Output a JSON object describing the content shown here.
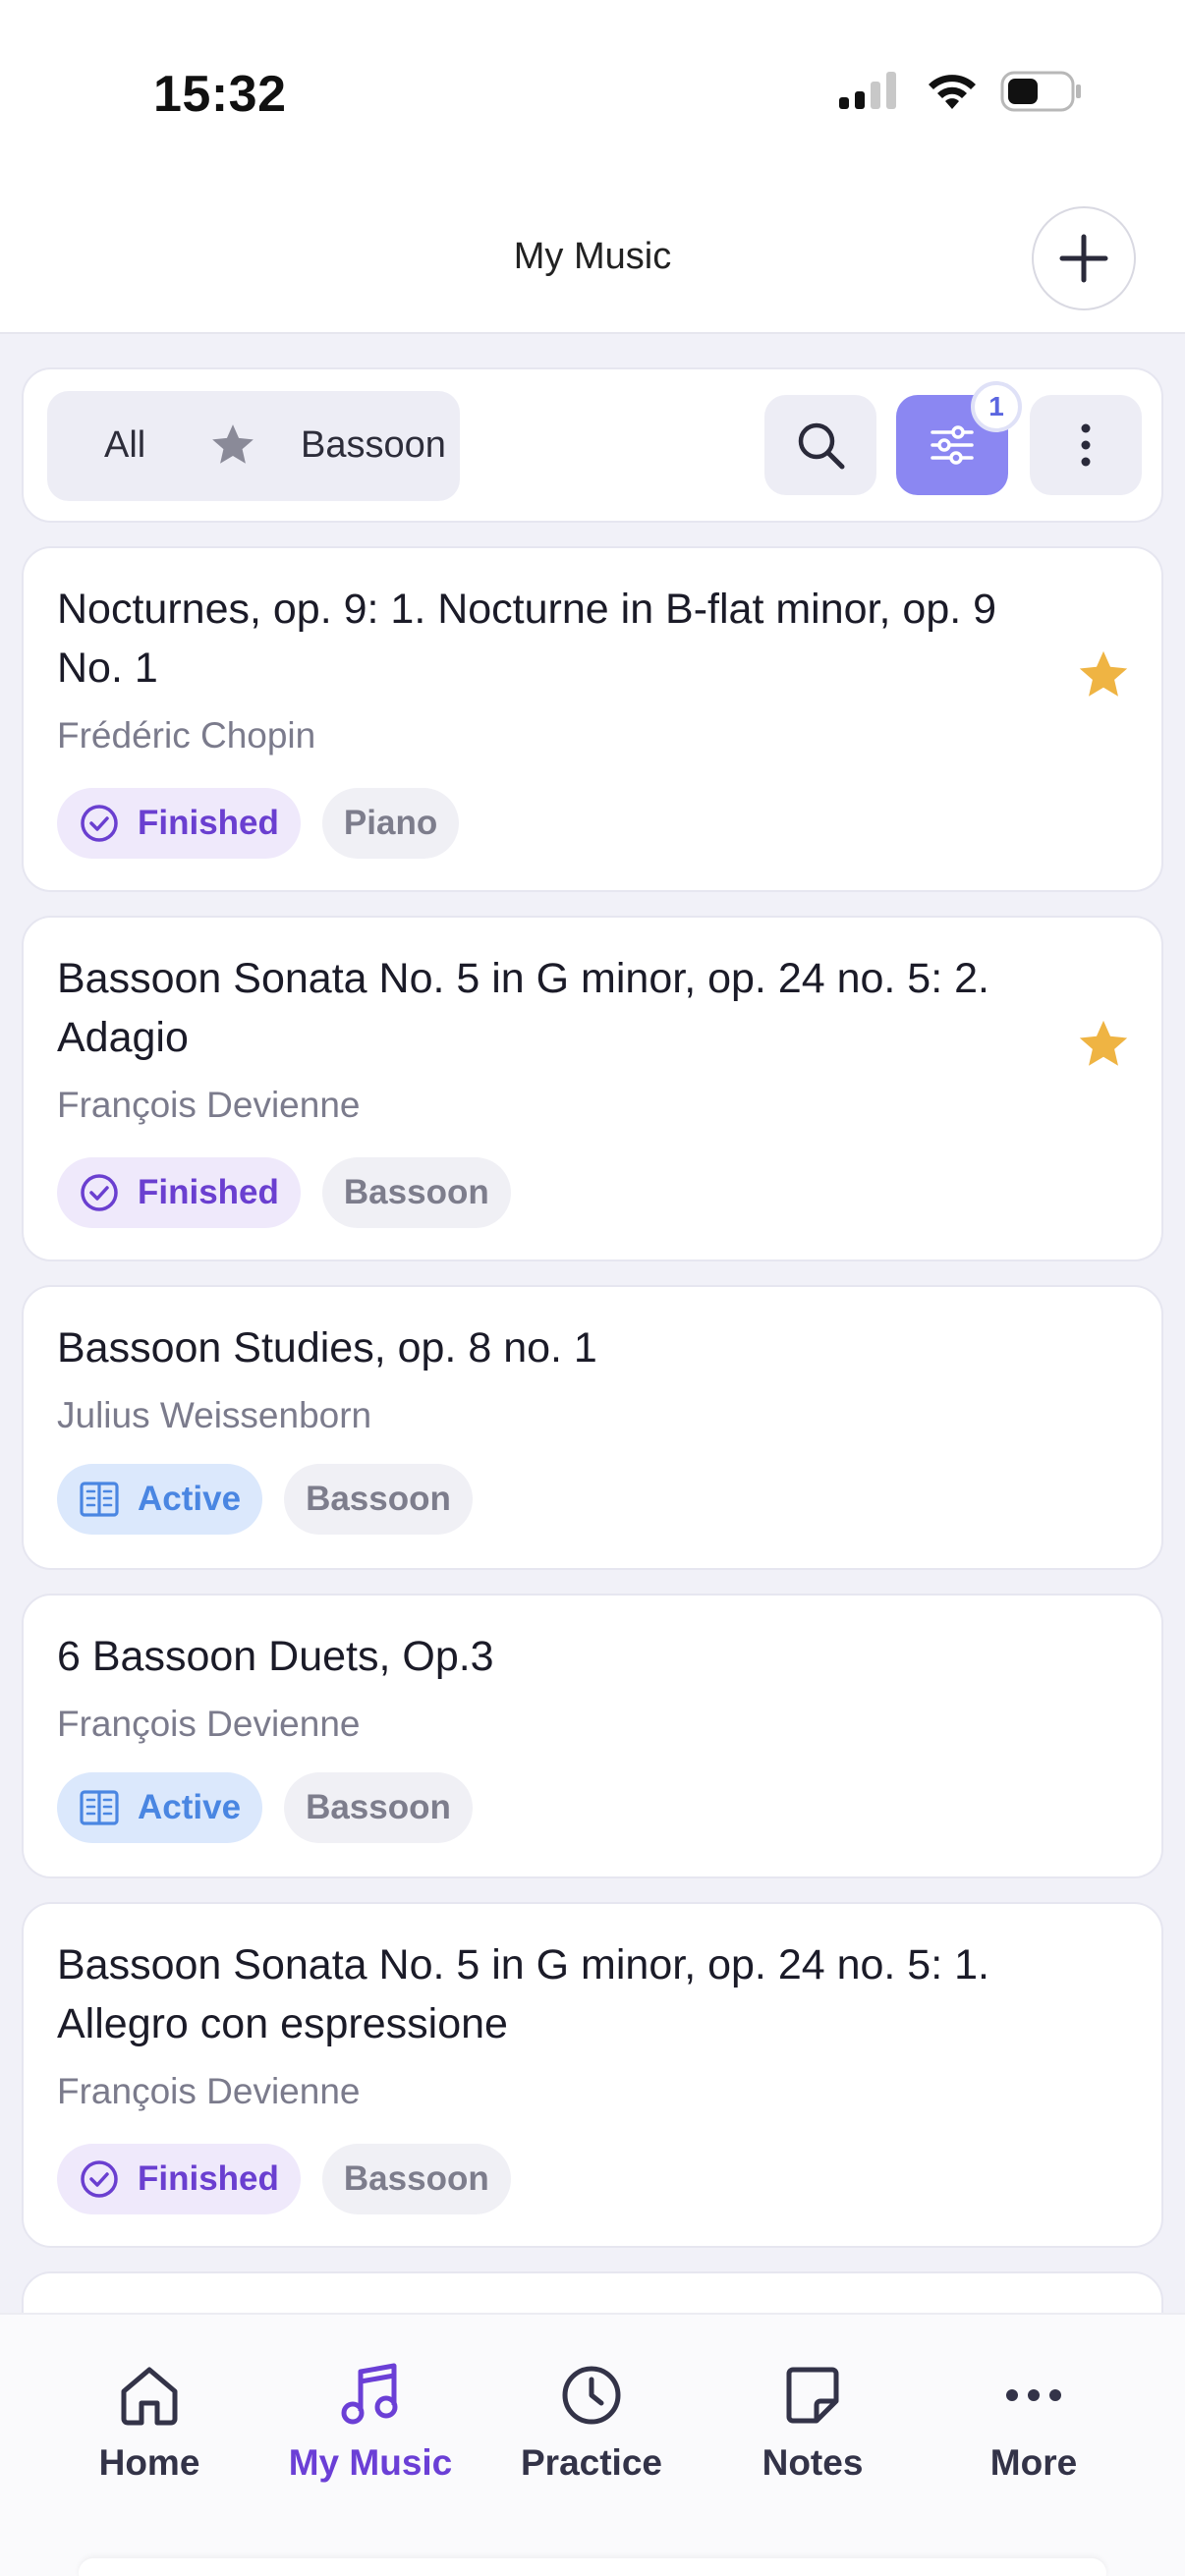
{
  "status_bar": {
    "time": "15:32"
  },
  "header": {
    "title": "My Music"
  },
  "filters": {
    "segment_all": "All",
    "segment_bassoon": "Bassoon",
    "active_filter_count": "1"
  },
  "cards": [
    {
      "title": "Nocturnes, op. 9: 1. Nocturne in B-flat minor, op. 9 No. 1",
      "composer": "Frédéric Chopin",
      "status": "Finished",
      "instrument": "Piano",
      "favorite": true
    },
    {
      "title": "Bassoon Sonata No. 5 in G minor, op. 24 no. 5: 2. Adagio",
      "composer": "François Devienne",
      "status": "Finished",
      "instrument": "Bassoon",
      "favorite": true
    },
    {
      "title": "Bassoon Studies, op. 8 no. 1",
      "composer": "Julius Weissenborn",
      "status": "Active",
      "instrument": "Bassoon",
      "favorite": false
    },
    {
      "title": "6 Bassoon Duets, Op.3",
      "composer": "François Devienne",
      "status": "Active",
      "instrument": "Bassoon",
      "favorite": false
    },
    {
      "title": "Bassoon Sonata No. 5 in G minor, op. 24 no. 5: 1. Allegro con espressione",
      "composer": "François Devienne",
      "status": "Finished",
      "instrument": "Bassoon",
      "favorite": false
    }
  ],
  "tabs": [
    {
      "label": "Home",
      "icon": "home-icon"
    },
    {
      "label": "My Music",
      "icon": "music-note-icon",
      "active": true
    },
    {
      "label": "Practice",
      "icon": "clock-icon"
    },
    {
      "label": "Notes",
      "icon": "note-icon"
    },
    {
      "label": "More",
      "icon": "ellipsis-icon"
    }
  ],
  "colors": {
    "accent": "#6b3fd6",
    "filter_button": "#8b87f2",
    "finished_bg": "#efe9fb",
    "active_bg": "#dbe8fc",
    "star": "#efb443"
  }
}
